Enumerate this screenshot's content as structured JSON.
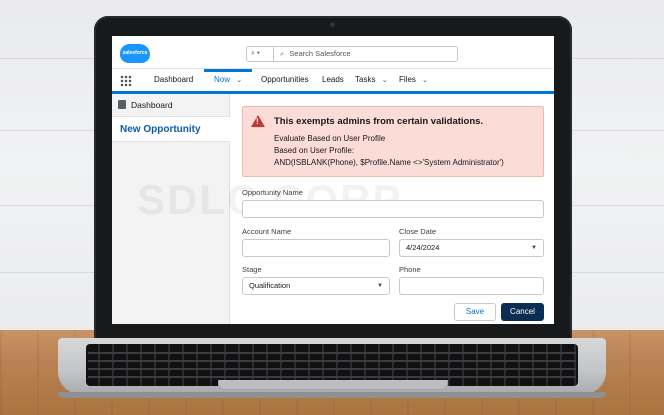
{
  "app": {
    "logo_text": "salesforce",
    "search": {
      "scope_label": "⌕ ▾",
      "placeholder": "Search Salesforce"
    }
  },
  "nav": {
    "items": [
      {
        "label": "Dashboard",
        "active": false,
        "has_menu": false
      },
      {
        "label": "Now",
        "active": true,
        "has_menu": true
      },
      {
        "label": "Opportunities",
        "active": false,
        "has_menu": false
      },
      {
        "label": "Leads",
        "active": false,
        "has_menu": false
      },
      {
        "label": "Tasks",
        "active": false,
        "has_menu": true
      },
      {
        "label": "Files",
        "active": false,
        "has_menu": true
      }
    ],
    "chevron": "⌄"
  },
  "sidebar": {
    "dashboard_label": "Dashboard",
    "current_label": "New Opportunity"
  },
  "alert": {
    "title": "This exempts admins from certain validations.",
    "lines": [
      "Evaluate Based on User Profile",
      "Based on User Profile:",
      "AND(ISBLANK(Phone), $Profile.Name <>'System Administrator')"
    ],
    "icon": "warning-icon"
  },
  "form": {
    "opportunity_name_label": "Opportunity Name",
    "opportunity_name_value": "",
    "account_name_label": "Account Name",
    "account_name_value": "",
    "close_date_label": "Close Date",
    "close_date_value": "4/24/2024",
    "stage_label": "Stage",
    "stage_value": "Qualification",
    "phone_label": "Phone",
    "phone_value": ""
  },
  "buttons": {
    "save": "Save",
    "cancel": "Cancel"
  },
  "watermark": "SDLC CORP",
  "colors": {
    "brand": "#0176d3",
    "alert_bg": "#fbdcd7",
    "alert_icon": "#c23934",
    "cancel_bg": "#0b2d52"
  }
}
